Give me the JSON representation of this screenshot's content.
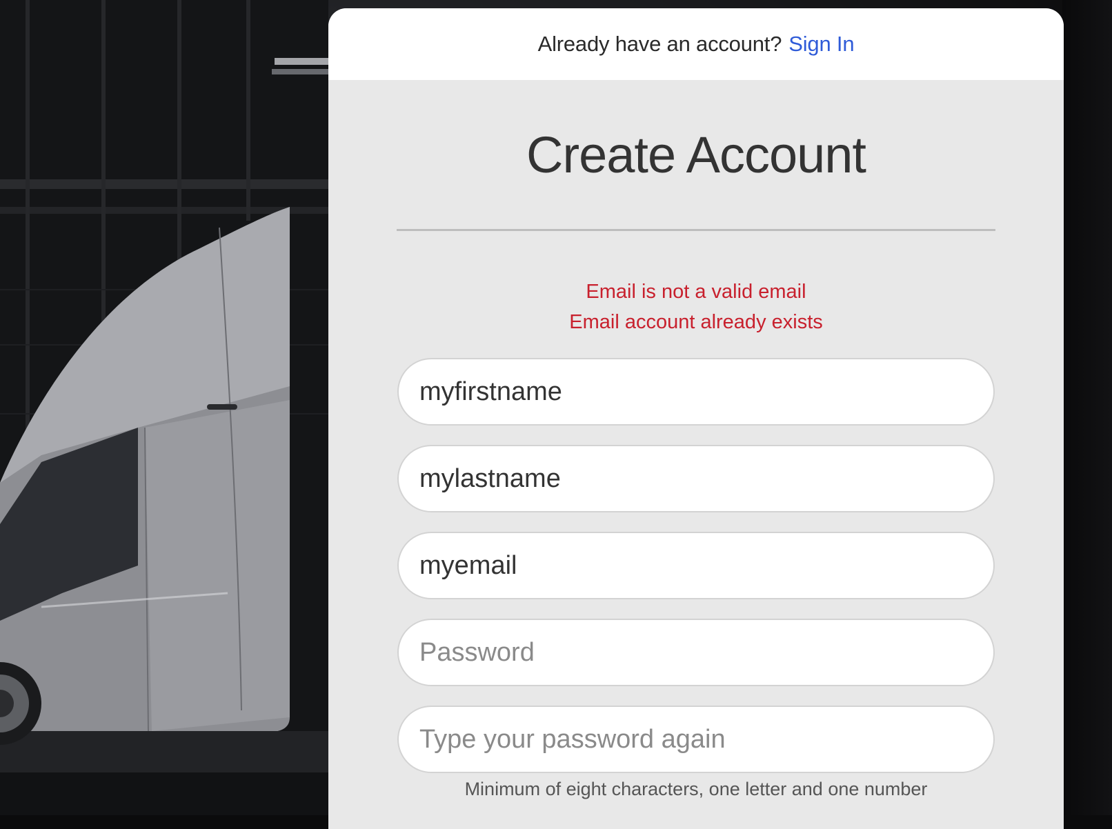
{
  "header": {
    "prompt_text": "Already have an account?",
    "signin_label": "Sign In",
    "link_color": "#2f5bd8"
  },
  "form": {
    "title": "Create Account",
    "errors": [
      "Email is not a valid email",
      "Email account already exists"
    ],
    "error_color": "#c8202d",
    "first_name": {
      "value": "myfirstname",
      "placeholder": ""
    },
    "last_name": {
      "value": "mylastname",
      "placeholder": ""
    },
    "email": {
      "value": "myemail",
      "placeholder": ""
    },
    "password": {
      "value": "",
      "placeholder": "Password"
    },
    "password_confirm": {
      "value": "",
      "placeholder": "Type your password again"
    },
    "password_hint": "Minimum of eight characters, one letter and one number"
  }
}
